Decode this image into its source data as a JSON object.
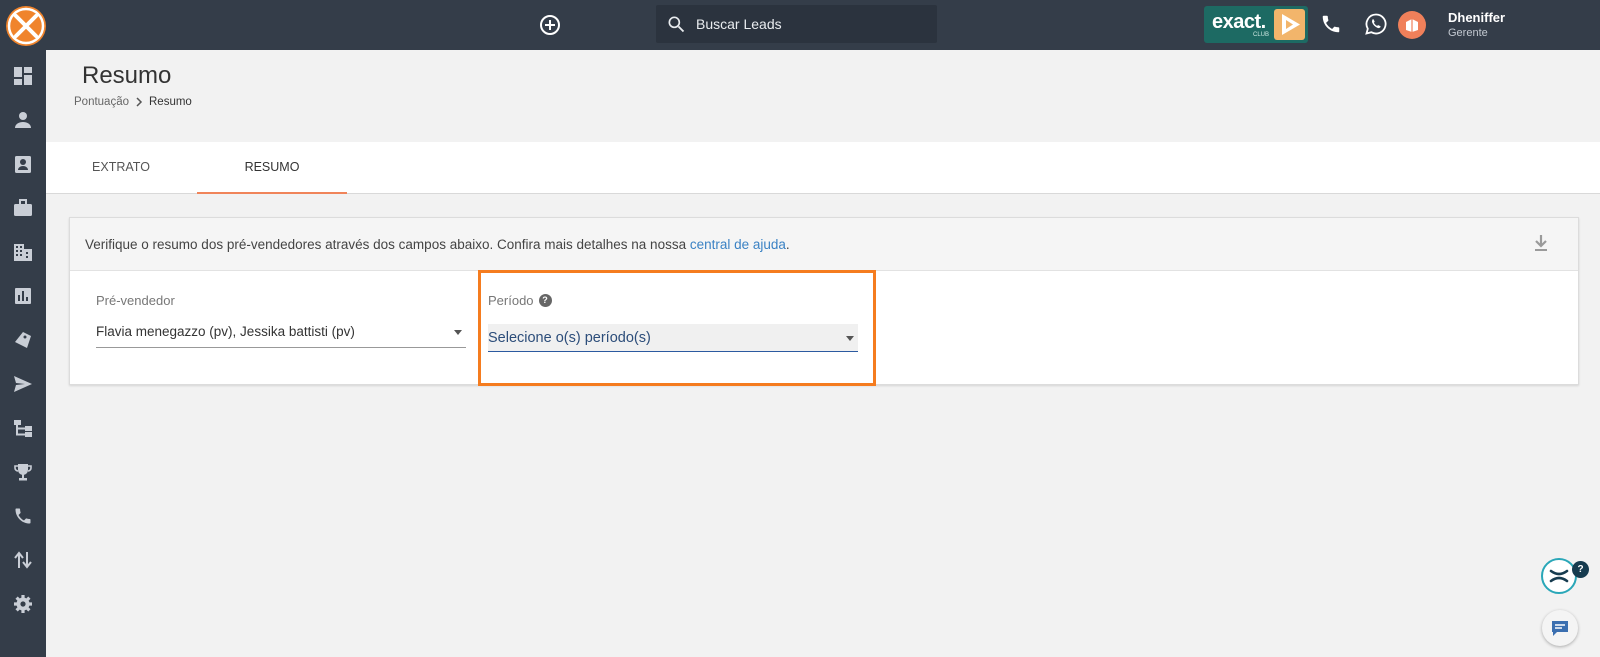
{
  "topbar": {
    "search_placeholder": "Buscar Leads",
    "exact_brand": "exact.",
    "exact_club": "CLUB",
    "user_name": "Dheniffer",
    "user_role": "Gerente"
  },
  "sidebar": {
    "items": [
      "dashboard-icon",
      "person-icon",
      "contact-card-icon",
      "briefcase-icon",
      "building-icon",
      "chart-icon",
      "tag-icon",
      "send-icon",
      "hierarchy-icon",
      "trophy-icon",
      "phone-icon",
      "swap-icon",
      "settings-icon"
    ]
  },
  "page": {
    "title": "Resumo",
    "breadcrumb": [
      "Pontuação",
      "Resumo"
    ]
  },
  "tabs": [
    {
      "label": "EXTRATO",
      "active": false
    },
    {
      "label": "RESUMO",
      "active": true
    }
  ],
  "card": {
    "info_text": "Verifique o resumo dos pré-vendedores através dos campos abaixo. Confira mais detalhes na nossa ",
    "help_link": "central de ajuda",
    "info_suffix": "."
  },
  "filters": {
    "prevendedor_label": "Pré-vendedor",
    "prevendedor_value": "Flavia menegazzo (pv), Jessika battisti (pv)",
    "periodo_label": "Período",
    "periodo_placeholder": "Selecione o(s) período(s)"
  },
  "fab": {
    "help_badge": "?"
  },
  "colors": {
    "topbar": "#343d49",
    "accent_orange": "#f0842c",
    "highlight": "#f57c1f",
    "link": "#3b82c4"
  }
}
